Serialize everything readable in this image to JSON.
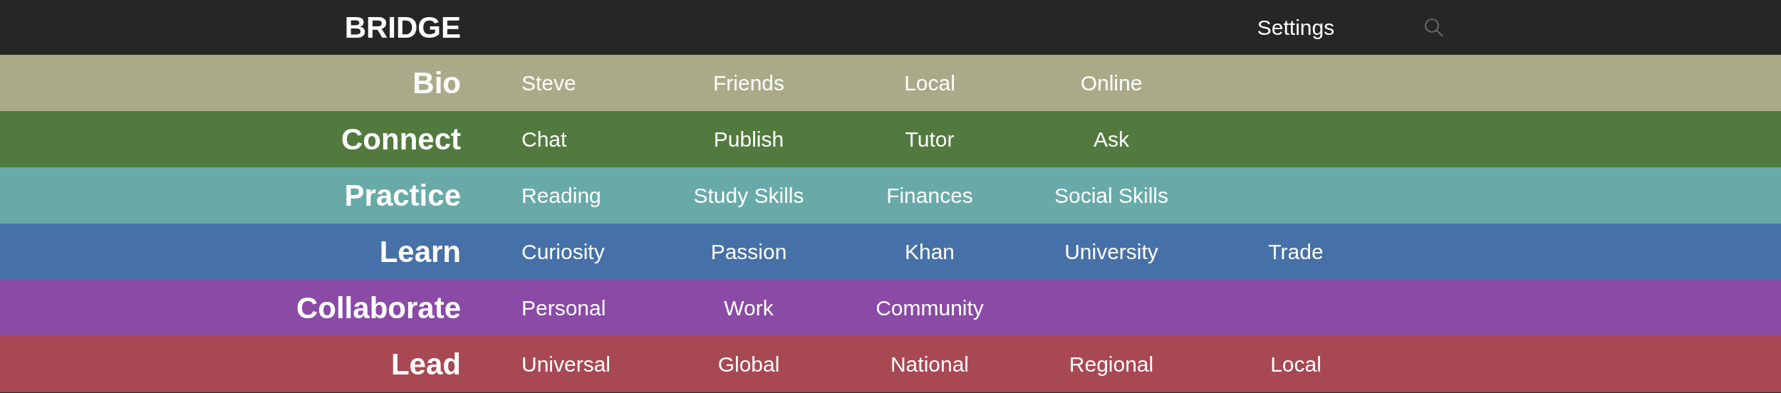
{
  "header": {
    "title": "BRIDGE",
    "settings": "Settings"
  },
  "sections": [
    {
      "label": "Bio",
      "color": "#a9ab88",
      "items": [
        "Steve",
        "Friends",
        "Local",
        "Online"
      ]
    },
    {
      "label": "Connect",
      "color": "#527a3e",
      "items": [
        "Chat",
        "Publish",
        "Tutor",
        "Ask"
      ]
    },
    {
      "label": "Practice",
      "color": "#68aaa8",
      "items": [
        "Reading",
        "Study Skills",
        "Finances",
        "Social Skills"
      ]
    },
    {
      "label": "Learn",
      "color": "#4670a8",
      "items": [
        "Curiosity",
        "Passion",
        "Khan",
        "University",
        "Trade"
      ]
    },
    {
      "label": "Collaborate",
      "color": "#8a4aa6",
      "items": [
        "Personal",
        "Work",
        "Community"
      ]
    },
    {
      "label": "Lead",
      "color": "#a84852",
      "items": [
        "Universal",
        "Global",
        "National",
        "Regional",
        "Local"
      ]
    }
  ]
}
